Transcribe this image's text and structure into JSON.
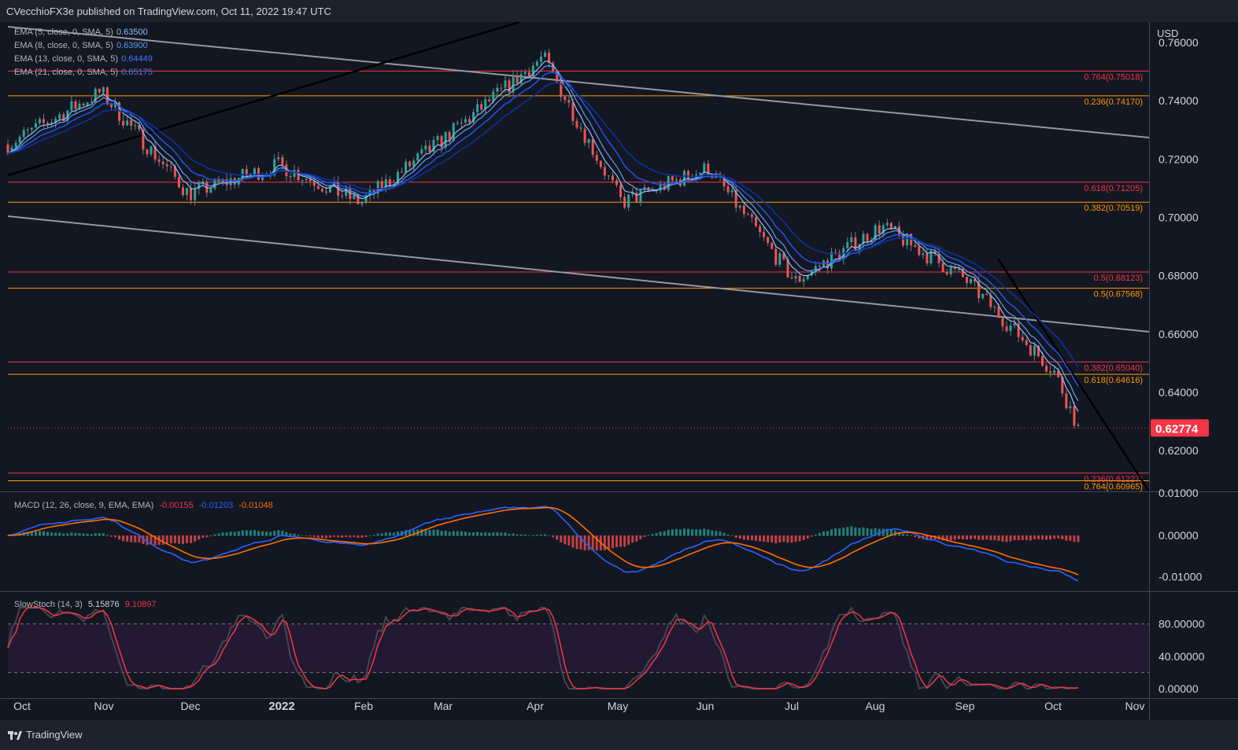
{
  "header": {
    "text": "CVecchioFX3e published on TradingView.com, Oct 11, 2022 19:47 UTC"
  },
  "footer": {
    "brand": "TradingView"
  },
  "price_pane": {
    "currency": "USD",
    "last_price": "0.62774",
    "last_color": "#f23645",
    "ema_legend": [
      {
        "label": "EMA (5, close, 0, SMA, 5)",
        "value": "0.63500",
        "color": "#90bff9"
      },
      {
        "label": "EMA (8, close, 0, SMA, 5)",
        "value": "0.63900",
        "color": "#5b9cf6"
      },
      {
        "label": "EMA (13, close, 0, SMA, 5)",
        "value": "0.64449",
        "color": "#1e53e5"
      },
      {
        "label": "EMA (21, close, 0, SMA, 5)",
        "value": "0.65175",
        "color": "#0c3299"
      }
    ],
    "fib_levels": [
      {
        "label": "0.764(0.75018)",
        "price": 0.75018,
        "color": "#f23645"
      },
      {
        "label": "0.236(0.74170)",
        "price": 0.7417,
        "color": "#ff9800"
      },
      {
        "label": "0.618(0.71205)",
        "price": 0.71205,
        "color": "#f23645"
      },
      {
        "label": "0.382(0.70519)",
        "price": 0.70519,
        "color": "#ff9800"
      },
      {
        "label": "0.5(0.68123)",
        "price": 0.68123,
        "color": "#f23645"
      },
      {
        "label": "0.5(0.67568)",
        "price": 0.67568,
        "color": "#ff9800"
      },
      {
        "label": "0.382(0.65040)",
        "price": 0.6504,
        "color": "#f23645"
      },
      {
        "label": "0.618(0.64616)",
        "price": 0.64616,
        "color": "#ff9800"
      },
      {
        "label": "0.236(0.61227)",
        "price": 0.61227,
        "color": "#f23645"
      },
      {
        "label": "0.764(0.60965)",
        "price": 0.60965,
        "color": "#ff9800"
      }
    ],
    "y_ticks": [
      "0.76000",
      "0.74000",
      "0.72000",
      "0.70000",
      "0.68000",
      "0.66000",
      "0.64000",
      "0.62000"
    ]
  },
  "macd_pane": {
    "label": "MACD (12, 26, close, 9, EMA, EMA)",
    "values": [
      {
        "v": "-0.00155",
        "color": "#f23645"
      },
      {
        "v": "-0.01203",
        "color": "#2962ff"
      },
      {
        "v": "-0.01048",
        "color": "#ff6d00"
      }
    ],
    "y_ticks": [
      "0.00000",
      "-0.01000"
    ],
    "top_tick_partial": "0.01000"
  },
  "stoch_pane": {
    "label": "SlowStoch (14, 3)",
    "values": [
      {
        "v": "5.15876",
        "color": "#d1d4dc"
      },
      {
        "v": "9.10897",
        "color": "#f23645"
      }
    ],
    "y_ticks": [
      "80.00000",
      "40.00000",
      "0.00000"
    ]
  },
  "x_axis": [
    "Oct",
    "Nov",
    "Dec",
    "2022",
    "Feb",
    "Mar",
    "Apr",
    "May",
    "Jun",
    "Jul",
    "Aug",
    "Sep",
    "Oct",
    "Nov"
  ],
  "chart_data": {
    "type": "line",
    "title": "",
    "ylabel": "USD",
    "x": [
      "Oct",
      "Nov",
      "Dec",
      "2022",
      "Feb",
      "Mar",
      "Apr",
      "May",
      "Jun",
      "Jul",
      "Aug",
      "Sep",
      "Oct",
      "Oct 11"
    ],
    "series": [
      {
        "values": [
          0.725,
          0.743,
          0.708,
          0.718,
          0.705,
          0.726,
          0.755,
          0.705,
          0.717,
          0.678,
          0.697,
          0.679,
          0.647,
          0.6277
        ]
      }
    ],
    "ylim": [
      0.606,
      0.767
    ],
    "grid": false
  }
}
